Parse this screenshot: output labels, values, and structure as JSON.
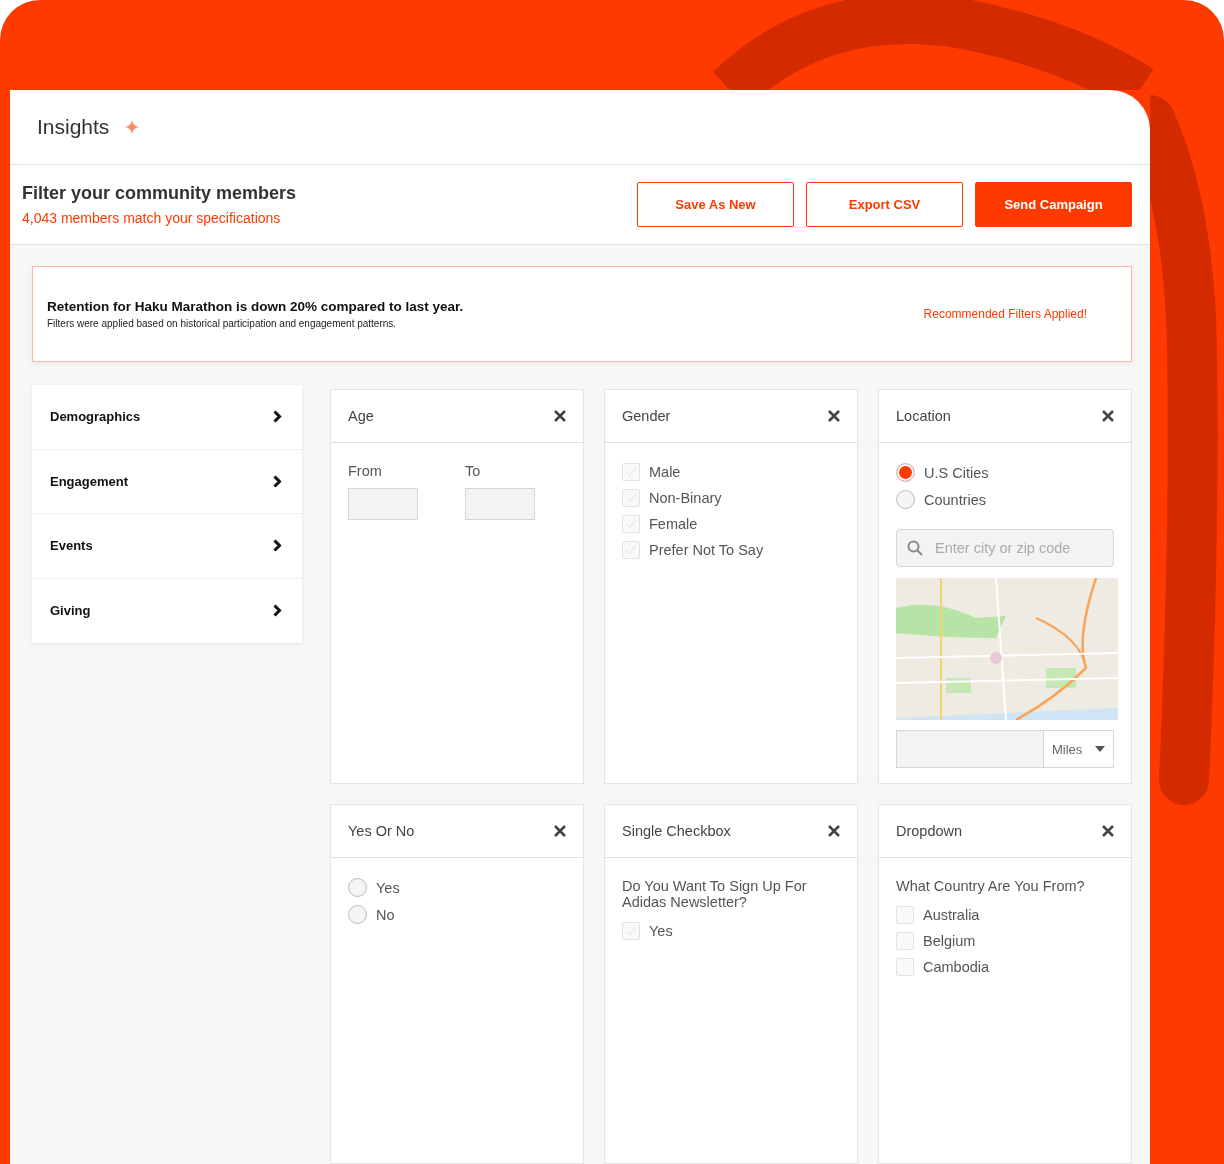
{
  "header": {
    "title": "Insights"
  },
  "filter_bar": {
    "title": "Filter your community members",
    "subtitle": "4,043 members match your specifications",
    "buttons": [
      {
        "label": "Save As New",
        "kind": "outline"
      },
      {
        "label": "Export CSV",
        "kind": "outline"
      },
      {
        "label": "Send Campaign",
        "kind": "primary"
      }
    ]
  },
  "alert": {
    "title": "Retention for Haku Marathon is down 20% compared to last year.",
    "text": "Filters were applied based on historical participation and engagement patterns.",
    "status": "Recommended Filters Applied!"
  },
  "sidebar": {
    "items": [
      {
        "label": "Demographics"
      },
      {
        "label": "Engagement"
      },
      {
        "label": "Events"
      },
      {
        "label": "Giving"
      }
    ]
  },
  "panels": [
    {
      "title": "Age",
      "kind": "range",
      "fields": [
        {
          "label": "From"
        },
        {
          "label": "To"
        }
      ]
    },
    {
      "title": "Gender",
      "kind": "checklist",
      "options": [
        {
          "label": "Male",
          "checked": false
        },
        {
          "label": "Non-Binary",
          "checked": false
        },
        {
          "label": "Female",
          "checked": false
        },
        {
          "label": "Prefer Not To Say",
          "checked": false
        }
      ]
    },
    {
      "title": "Location",
      "kind": "location",
      "options": [
        {
          "label": "U.S Cities",
          "selected": true
        },
        {
          "label": "Countries",
          "selected": false
        }
      ],
      "search": {
        "placeholder": "Enter city or zip code"
      },
      "map": {
        "kind": "picture"
      },
      "unit": "Miles"
    },
    {
      "title": "Yes Or No",
      "kind": "radio",
      "options": [
        {
          "label": "Yes",
          "selected": false
        },
        {
          "label": "No",
          "selected": false
        }
      ]
    },
    {
      "title": "Single Checkbox",
      "kind": "checklist",
      "question": "Do You Want To Sign Up For Adidas Newsletter?",
      "options": [
        {
          "label": "Yes",
          "checked": false
        }
      ]
    },
    {
      "title": "Dropdown",
      "kind": "boxes",
      "question": "What Country Are You From?",
      "options": [
        {
          "label": "Australia",
          "checked": false
        },
        {
          "label": "Belgium",
          "checked": false
        },
        {
          "label": "Cambodia",
          "checked": false
        }
      ]
    }
  ]
}
